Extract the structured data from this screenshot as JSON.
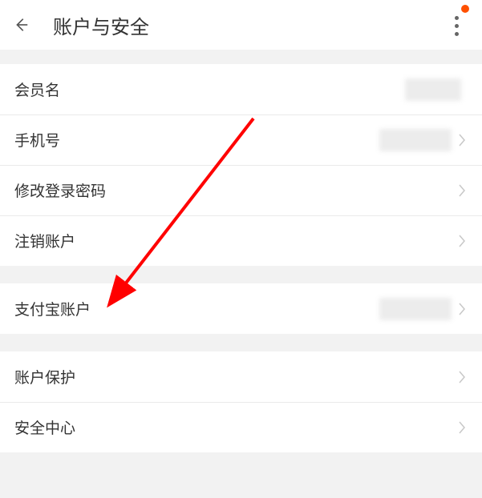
{
  "header": {
    "title": "账户与安全"
  },
  "rows": {
    "membername": {
      "label": "会员名"
    },
    "phone": {
      "label": "手机号"
    },
    "changepwd": {
      "label": "修改登录密码"
    },
    "deactivate": {
      "label": "注销账户"
    },
    "alipay": {
      "label": "支付宝账户"
    },
    "protection": {
      "label": "账户保护"
    },
    "security": {
      "label": "安全中心"
    }
  }
}
